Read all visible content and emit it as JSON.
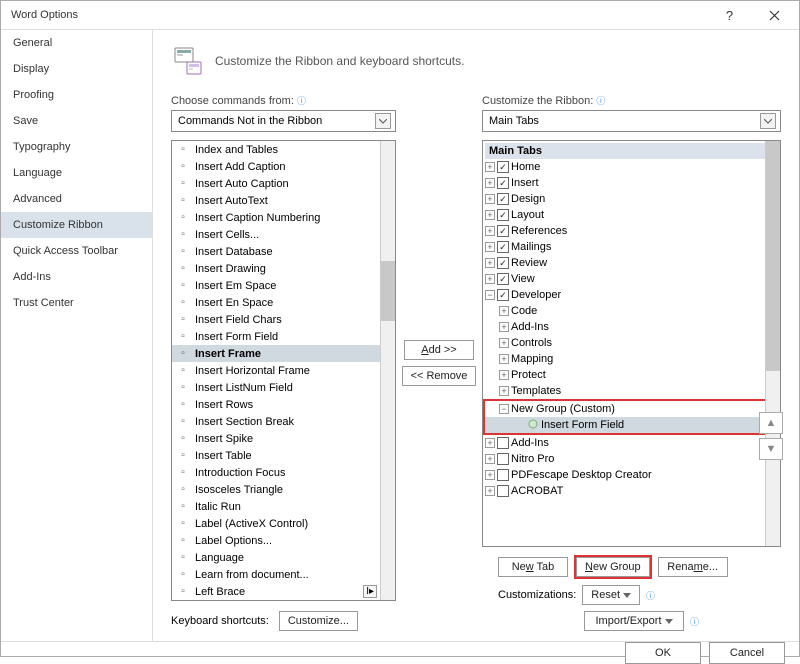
{
  "title": "Word Options",
  "sidebar": {
    "items": [
      {
        "label": "General"
      },
      {
        "label": "Display"
      },
      {
        "label": "Proofing"
      },
      {
        "label": "Save"
      },
      {
        "label": "Typography"
      },
      {
        "label": "Language"
      },
      {
        "label": "Advanced"
      },
      {
        "label": "Customize Ribbon",
        "selected": true
      },
      {
        "label": "Quick Access Toolbar"
      },
      {
        "label": "Add-Ins"
      },
      {
        "label": "Trust Center"
      }
    ]
  },
  "heading": "Customize the Ribbon and keyboard shortcuts.",
  "left_panel": {
    "label": "Choose commands from:",
    "combo": "Commands Not in the Ribbon",
    "commands": [
      "Index and Tables",
      "Insert Add Caption",
      "Insert Auto Caption",
      "Insert AutoText",
      "Insert Caption Numbering",
      "Insert Cells...",
      "Insert Database",
      "Insert Drawing",
      "Insert Em Space",
      "Insert En Space",
      "Insert Field Chars",
      "Insert Form Field",
      "Insert Frame",
      "Insert Horizontal Frame",
      "Insert ListNum Field",
      "Insert Rows",
      "Insert Section Break",
      "Insert Spike",
      "Insert Table",
      "Introduction Focus",
      "Isosceles Triangle",
      "Italic Run",
      "Label (ActiveX Control)",
      "Label Options...",
      "Language",
      "Learn from document...",
      "Left Brace"
    ],
    "selected_index": 12
  },
  "mid": {
    "add": "Add >>",
    "remove": "<< Remove"
  },
  "right_panel": {
    "label": "Customize the Ribbon:",
    "combo": "Main Tabs",
    "tree_header": "Main Tabs",
    "tabs": [
      {
        "label": "Home",
        "checked": true,
        "expandable": true,
        "collapsed": true
      },
      {
        "label": "Insert",
        "checked": true,
        "expandable": true,
        "collapsed": true
      },
      {
        "label": "Design",
        "checked": true,
        "expandable": true,
        "collapsed": true
      },
      {
        "label": "Layout",
        "checked": true,
        "expandable": true,
        "collapsed": true
      },
      {
        "label": "References",
        "checked": true,
        "expandable": true,
        "collapsed": true
      },
      {
        "label": "Mailings",
        "checked": true,
        "expandable": true,
        "collapsed": true
      },
      {
        "label": "Review",
        "checked": true,
        "expandable": true,
        "collapsed": true
      },
      {
        "label": "View",
        "checked": true,
        "expandable": true,
        "collapsed": true
      },
      {
        "label": "Developer",
        "checked": true,
        "expandable": true,
        "collapsed": false,
        "children": [
          {
            "label": "Code",
            "expandable": true,
            "collapsed": true
          },
          {
            "label": "Add-Ins",
            "expandable": true,
            "collapsed": true
          },
          {
            "label": "Controls",
            "expandable": true,
            "collapsed": true
          },
          {
            "label": "Mapping",
            "expandable": true,
            "collapsed": true
          },
          {
            "label": "Protect",
            "expandable": true,
            "collapsed": true
          },
          {
            "label": "Templates",
            "expandable": true,
            "collapsed": true
          }
        ],
        "custom_group": {
          "label": "New Group (Custom)",
          "child": "Insert Form Field"
        }
      },
      {
        "label": "Add-Ins",
        "checked": false,
        "expandable": true,
        "collapsed": true
      },
      {
        "label": "Nitro Pro",
        "checked": false,
        "expandable": true,
        "collapsed": true
      },
      {
        "label": "PDFescape Desktop Creator",
        "checked": false,
        "expandable": true,
        "collapsed": true
      },
      {
        "label": "ACROBAT",
        "checked": false,
        "expandable": true,
        "collapsed": true
      }
    ],
    "buttons": {
      "newtab": "New Tab",
      "newgroup": "New Group",
      "rename": "Rename..."
    },
    "custom_label": "Customizations:",
    "reset": "Reset",
    "import": "Import/Export"
  },
  "kbs": {
    "label": "Keyboard shortcuts:",
    "button": "Customize..."
  },
  "footer": {
    "ok": "OK",
    "cancel": "Cancel"
  }
}
